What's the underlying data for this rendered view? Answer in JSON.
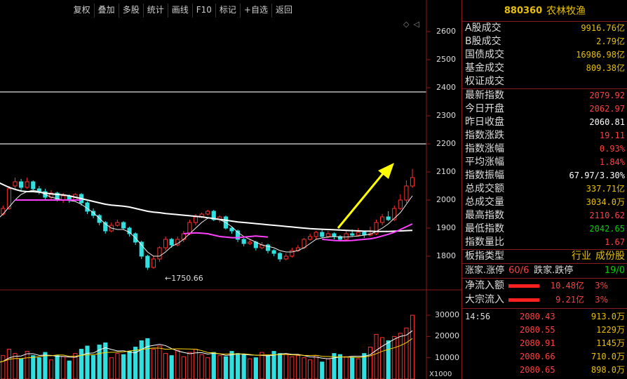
{
  "toolbar": [
    "复权",
    "叠加",
    "多股",
    "统计",
    "画线",
    "F10",
    "标记",
    "+自选",
    "返回"
  ],
  "mini_icons": [
    "◇",
    "◁"
  ],
  "price_axis": [
    "2600",
    "2500",
    "2400",
    "2300",
    "2200",
    "2100",
    "2000",
    "1900",
    "1800"
  ],
  "volume_axis": [
    "30000",
    "20000",
    "10000"
  ],
  "volume_unit": "X1000",
  "low_annotation": "1750.66",
  "colors": {
    "up": "#ff3030",
    "down": "#30e0e0",
    "ma5": "#ffffff",
    "ma10": "#ffd700",
    "ma20": "#ff40ff",
    "arrow": "#ffff00",
    "border": "#8b1a1a"
  },
  "chart_data": {
    "type": "candlestick",
    "ylim": [
      1750,
      2650
    ],
    "candles": [
      [
        1930,
        1910,
        1940,
        1900
      ],
      [
        1920,
        1925,
        1935,
        1905
      ],
      [
        1925,
        1960,
        1965,
        1915
      ],
      [
        1960,
        1950,
        1975,
        1940
      ],
      [
        1950,
        1970,
        1980,
        1945
      ],
      [
        1970,
        2040,
        2050,
        1965
      ],
      [
        2050,
        2065,
        2080,
        2040
      ],
      [
        2065,
        2045,
        2075,
        2030
      ],
      [
        2045,
        2065,
        2080,
        2040
      ],
      [
        2065,
        2040,
        2070,
        2030
      ],
      [
        2040,
        2030,
        2050,
        2020
      ],
      [
        2030,
        2010,
        2040,
        2000
      ],
      [
        2010,
        2025,
        2035,
        2000
      ],
      [
        2025,
        2000,
        2030,
        1995
      ],
      [
        2000,
        2015,
        2025,
        1990
      ],
      [
        2015,
        2000,
        2020,
        1990
      ],
      [
        2000,
        2020,
        2025,
        1995
      ],
      [
        2020,
        1990,
        2025,
        1980
      ],
      [
        1990,
        1960,
        1995,
        1950
      ],
      [
        1960,
        1945,
        1970,
        1935
      ],
      [
        1945,
        1920,
        1950,
        1910
      ],
      [
        1920,
        1890,
        1925,
        1880
      ],
      [
        1890,
        1910,
        1920,
        1885
      ],
      [
        1910,
        1920,
        1930,
        1905
      ],
      [
        1920,
        1900,
        1925,
        1895
      ],
      [
        1900,
        1880,
        1905,
        1870
      ],
      [
        1880,
        1850,
        1885,
        1840
      ],
      [
        1850,
        1800,
        1855,
        1790
      ],
      [
        1800,
        1760,
        1805,
        1751
      ],
      [
        1760,
        1790,
        1800,
        1755
      ],
      [
        1790,
        1830,
        1835,
        1780
      ],
      [
        1830,
        1860,
        1870,
        1820
      ],
      [
        1860,
        1840,
        1865,
        1830
      ],
      [
        1840,
        1860,
        1870,
        1835
      ],
      [
        1860,
        1880,
        1890,
        1850
      ],
      [
        1880,
        1920,
        1930,
        1875
      ],
      [
        1920,
        1940,
        1950,
        1910
      ],
      [
        1940,
        1950,
        1955,
        1935
      ],
      [
        1950,
        1960,
        1965,
        1945
      ],
      [
        1960,
        1930,
        1965,
        1925
      ],
      [
        1930,
        1940,
        1945,
        1920
      ],
      [
        1940,
        1900,
        1945,
        1895
      ],
      [
        1900,
        1890,
        1905,
        1880
      ],
      [
        1890,
        1860,
        1895,
        1850
      ],
      [
        1860,
        1845,
        1865,
        1835
      ],
      [
        1845,
        1850,
        1860,
        1840
      ],
      [
        1850,
        1830,
        1855,
        1820
      ],
      [
        1830,
        1840,
        1850,
        1825
      ],
      [
        1840,
        1820,
        1845,
        1810
      ],
      [
        1820,
        1810,
        1825,
        1800
      ],
      [
        1810,
        1790,
        1815,
        1780
      ],
      [
        1790,
        1800,
        1810,
        1785
      ],
      [
        1800,
        1820,
        1830,
        1795
      ],
      [
        1820,
        1830,
        1840,
        1815
      ],
      [
        1830,
        1860,
        1865,
        1825
      ],
      [
        1860,
        1870,
        1880,
        1855
      ],
      [
        1870,
        1885,
        1890,
        1860
      ],
      [
        1885,
        1870,
        1895,
        1865
      ],
      [
        1870,
        1880,
        1890,
        1865
      ],
      [
        1880,
        1870,
        1885,
        1860
      ],
      [
        1870,
        1860,
        1875,
        1855
      ],
      [
        1860,
        1880,
        1890,
        1855
      ],
      [
        1880,
        1875,
        1895,
        1870
      ],
      [
        1875,
        1885,
        1900,
        1870
      ],
      [
        1885,
        1875,
        1890,
        1865
      ],
      [
        1875,
        1880,
        1905,
        1870
      ],
      [
        1880,
        1920,
        1930,
        1875
      ],
      [
        1920,
        1940,
        1950,
        1910
      ],
      [
        1940,
        1930,
        1960,
        1925
      ],
      [
        1930,
        1970,
        1980,
        1925
      ],
      [
        1970,
        2000,
        2020,
        1965
      ],
      [
        2000,
        2050,
        2070,
        1990
      ],
      [
        2050,
        2080,
        2111,
        2043
      ]
    ],
    "ma_white": [
      2095,
      2085,
      2075,
      2065,
      2055,
      2045,
      2038,
      2032,
      2030,
      2030,
      2028,
      2025,
      2022,
      2020,
      2018,
      2015,
      2010,
      2005,
      2000,
      1995,
      1990,
      1985,
      1982,
      1980,
      1978,
      1975,
      1970,
      1965,
      1960,
      1957,
      1955,
      1952,
      1950,
      1948,
      1946,
      1944,
      1942,
      1940,
      1937,
      1934,
      1931,
      1928,
      1925,
      1922,
      1920,
      1918,
      1916,
      1914,
      1912,
      1910,
      1908,
      1906,
      1904,
      1902,
      1900,
      1898,
      1897,
      1896,
      1895,
      1894,
      1893,
      1892,
      1891,
      1890,
      1889,
      1889,
      1888,
      1888,
      1888,
      1889,
      1890,
      1891,
      1892
    ],
    "ma_short": [
      1920,
      1910,
      1915,
      1930,
      1950,
      1975,
      2000,
      2020,
      2030,
      2035,
      2030,
      2020,
      2010,
      2005,
      2000,
      1998,
      1995,
      1985,
      1970,
      1955,
      1935,
      1915,
      1900,
      1895,
      1895,
      1885,
      1865,
      1840,
      1815,
      1800,
      1800,
      1815,
      1835,
      1845,
      1860,
      1880,
      1900,
      1920,
      1935,
      1935,
      1930,
      1920,
      1905,
      1885,
      1870,
      1860,
      1850,
      1840,
      1835,
      1830,
      1820,
      1815,
      1815,
      1820,
      1830,
      1845,
      1860,
      1865,
      1868,
      1870,
      1868,
      1868,
      1870,
      1872,
      1875,
      1878,
      1888,
      1900,
      1915,
      1935,
      1955,
      1985,
      2015
    ],
    "ma_magenta": [
      null,
      null,
      null,
      null,
      null,
      null,
      2000,
      2000,
      2000,
      2000,
      2000,
      2000,
      2000,
      2000,
      2000,
      2000,
      2000,
      2000,
      null,
      null,
      null,
      null,
      null,
      null,
      null,
      null,
      null,
      null,
      null,
      null,
      null,
      null,
      null,
      null,
      1880,
      1882,
      1883,
      1882,
      1880,
      1875,
      1870,
      1868,
      1866,
      1866,
      1868,
      1870,
      1872,
      1870,
      1868,
      null,
      null,
      null,
      null,
      null,
      null,
      null,
      null,
      1860,
      1858,
      1856,
      1855,
      1855,
      1856,
      1858,
      1860,
      1862,
      1866,
      1872,
      1878,
      1885,
      1895,
      1905,
      1915
    ],
    "volumes": [
      6000,
      8000,
      9000,
      7500,
      11000,
      14000,
      12000,
      9500,
      13000,
      11000,
      10000,
      12500,
      9000,
      11000,
      10500,
      8500,
      12000,
      14000,
      15500,
      11000,
      16000,
      17000,
      10000,
      12000,
      11500,
      13000,
      15000,
      18000,
      19000,
      14000,
      15500,
      12000,
      11000,
      13500,
      10500,
      12500,
      14000,
      11500,
      10000,
      12500,
      11000,
      10500,
      13000,
      12000,
      11500,
      9500,
      10000,
      12500,
      11000,
      13000,
      12000,
      11500,
      10500,
      11000,
      10000,
      9000,
      11000,
      8000,
      9500,
      12000,
      11500,
      10500,
      10000,
      9500,
      12000,
      15000,
      21000,
      19500,
      18000,
      20000,
      21500,
      24000,
      30000
    ],
    "vol_ylim": [
      0,
      33000
    ]
  },
  "panel": {
    "code": "880360",
    "name": "农林牧渔",
    "trade_rows": [
      {
        "label": "A股成交",
        "value": "9916.76亿",
        "color": "yellow"
      },
      {
        "label": "B股成交",
        "value": "2.79亿",
        "color": "yellow"
      },
      {
        "label": "国债成交",
        "value": "16986.98亿",
        "color": "yellow"
      },
      {
        "label": "基金成交",
        "value": "809.38亿",
        "color": "yellow"
      },
      {
        "label": "权证成交",
        "value": "",
        "color": "yellow"
      }
    ],
    "index_rows": [
      {
        "label": "最新指数",
        "value": "2079.92",
        "color": "red"
      },
      {
        "label": "今日开盘",
        "value": "2062.97",
        "color": "red"
      },
      {
        "label": "昨日收盘",
        "value": "2060.81",
        "color": "white"
      },
      {
        "label": "指数涨跌",
        "value": "19.11",
        "color": "red"
      },
      {
        "label": "指数涨幅",
        "value": "0.93%",
        "color": "red"
      },
      {
        "label": "平均涨幅",
        "value": "1.84%",
        "color": "red"
      },
      {
        "label": "指数振幅",
        "value": "67.97/3.30%",
        "color": "white"
      },
      {
        "label": "总成交额",
        "value": "337.71亿",
        "color": "yellow"
      },
      {
        "label": "总成交量",
        "value": "3034.0万",
        "color": "yellow"
      },
      {
        "label": "最高指数",
        "value": "2110.62",
        "color": "red"
      },
      {
        "label": "最低指数",
        "value": "2042.65",
        "color": "green"
      },
      {
        "label": "指数量比",
        "value": "1.67",
        "color": "red"
      }
    ],
    "category": {
      "label": "板指类型",
      "links": [
        "行业",
        "成份股"
      ]
    },
    "limits": {
      "up_label": "涨家.涨停",
      "up_value": "60/6",
      "down_label": "跌家.跌停",
      "down_value": "19/0"
    },
    "flows": [
      {
        "label": "净流入额",
        "value": "10.48亿",
        "pct": "3%"
      },
      {
        "label": "大宗流入",
        "value": "9.21亿",
        "pct": "3%"
      }
    ],
    "ticks": [
      {
        "time": "14:56",
        "price": "2080.43",
        "vol": "913.0万"
      },
      {
        "time": "",
        "price": "2080.55",
        "vol": "1229万"
      },
      {
        "time": "",
        "price": "2080.91",
        "vol": "1145万"
      },
      {
        "time": "",
        "price": "2080.66",
        "vol": "710.0万"
      },
      {
        "time": "",
        "price": "2080.65",
        "vol": "898.0万"
      }
    ]
  }
}
